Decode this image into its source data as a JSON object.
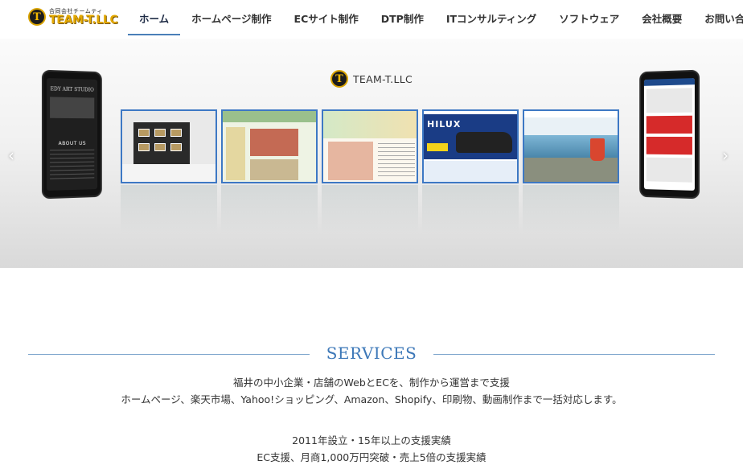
{
  "header": {
    "logo_sub": "合同会社チームティ",
    "logo_main": "TEAM-T.LLC",
    "logo_mark": "T",
    "nav": [
      {
        "label": "ホーム",
        "active": true
      },
      {
        "label": "ホームページ制作",
        "active": false
      },
      {
        "label": "ECサイト制作",
        "active": false
      },
      {
        "label": "DTP制作",
        "active": false
      },
      {
        "label": "ITコンサルティング",
        "active": false
      },
      {
        "label": "ソフトウェア",
        "active": false
      },
      {
        "label": "会社概要",
        "active": false
      },
      {
        "label": "お問い合わせ",
        "active": false
      }
    ]
  },
  "hero": {
    "logo_mark": "T",
    "logo_text": "TEAM-T.LLC",
    "prev_icon": "chevron-left-icon",
    "next_icon": "chevron-right-icon",
    "prev_glyph": "‹",
    "next_glyph": "›",
    "phone_left": {
      "title": "EDY ART STUDIO",
      "about": "ABOUT US"
    },
    "slide_hilux_text": "HILUX"
  },
  "services": {
    "title": "SERVICES",
    "line1": "福井の中小企業・店舗のWebとECを、制作から運営まで支援",
    "line2": "ホームページ、楽天市場、Yahoo!ショッピング、Amazon、Shopify、印刷物、動画制作まで一括対応します。",
    "line3": "2011年設立・15年以上の支援実績",
    "line4": "EC支援、月商1,000万円突破・売上5倍の支援実績"
  },
  "colors": {
    "accent": "#3d78b8",
    "nav_underline": "#4a7fb8",
    "logo_gold": "#e3a800"
  }
}
